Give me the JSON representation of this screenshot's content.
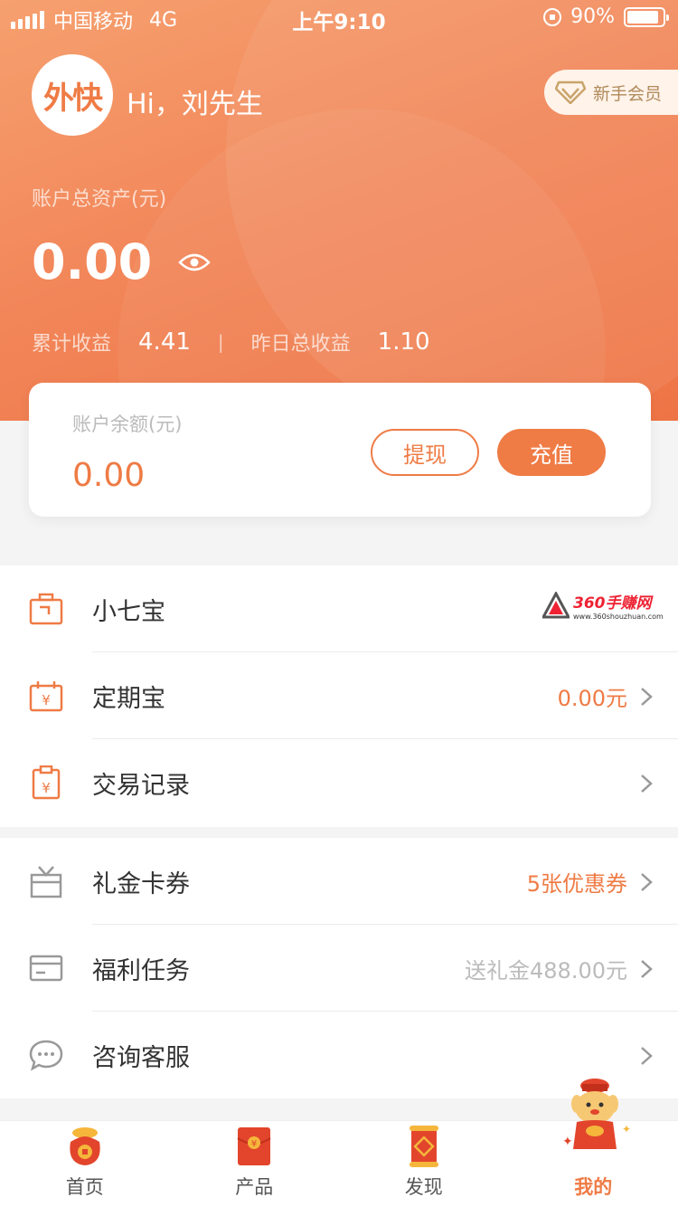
{
  "status_bar": {
    "carrier": "中国移动",
    "network": "4G",
    "time": "上午9:10",
    "battery": "90%"
  },
  "header": {
    "avatar_text": "外快",
    "greeting": "Hi，刘先生",
    "member_badge": "新手会员",
    "total_assets_label": "账户总资产(元)",
    "total_assets_value": "0.00",
    "cumulative_income_label": "累计收益",
    "cumulative_income_value": "4.41",
    "separator": "|",
    "yesterday_income_label": "昨日总收益",
    "yesterday_income_value": "1.10"
  },
  "balance_card": {
    "label": "账户余额(元)",
    "value": "0.00",
    "withdraw_label": "提现",
    "recharge_label": "充值"
  },
  "menu_group_1": [
    {
      "label": "小七宝",
      "value": "",
      "icon": "briefcase-icon"
    },
    {
      "label": "定期宝",
      "value": "0.00元",
      "icon": "calendar-yen-icon"
    },
    {
      "label": "交易记录",
      "value": "",
      "icon": "clipboard-yen-icon"
    }
  ],
  "menu_group_2": [
    {
      "label": "礼金卡券",
      "value": "5张优惠券",
      "icon": "gift-box-icon"
    },
    {
      "label": "福利任务",
      "value": "送礼金488.00元",
      "icon": "card-icon"
    },
    {
      "label": "咨询客服",
      "value": "",
      "icon": "chat-bubble-icon"
    }
  ],
  "watermark": {
    "title": "360手赚网",
    "url": "www.360shouzhuan.com"
  },
  "tabbar": [
    {
      "label": "首页",
      "icon": "money-bag-icon",
      "active": false
    },
    {
      "label": "产品",
      "icon": "red-envelope-icon",
      "active": false
    },
    {
      "label": "发现",
      "icon": "scroll-icon",
      "active": false
    },
    {
      "label": "我的",
      "icon": "fortune-god-icon",
      "active": true
    }
  ],
  "colors": {
    "accent": "#ef7b45",
    "header_gradient_start": "#f6a06f",
    "header_gradient_end": "#ee7445"
  }
}
